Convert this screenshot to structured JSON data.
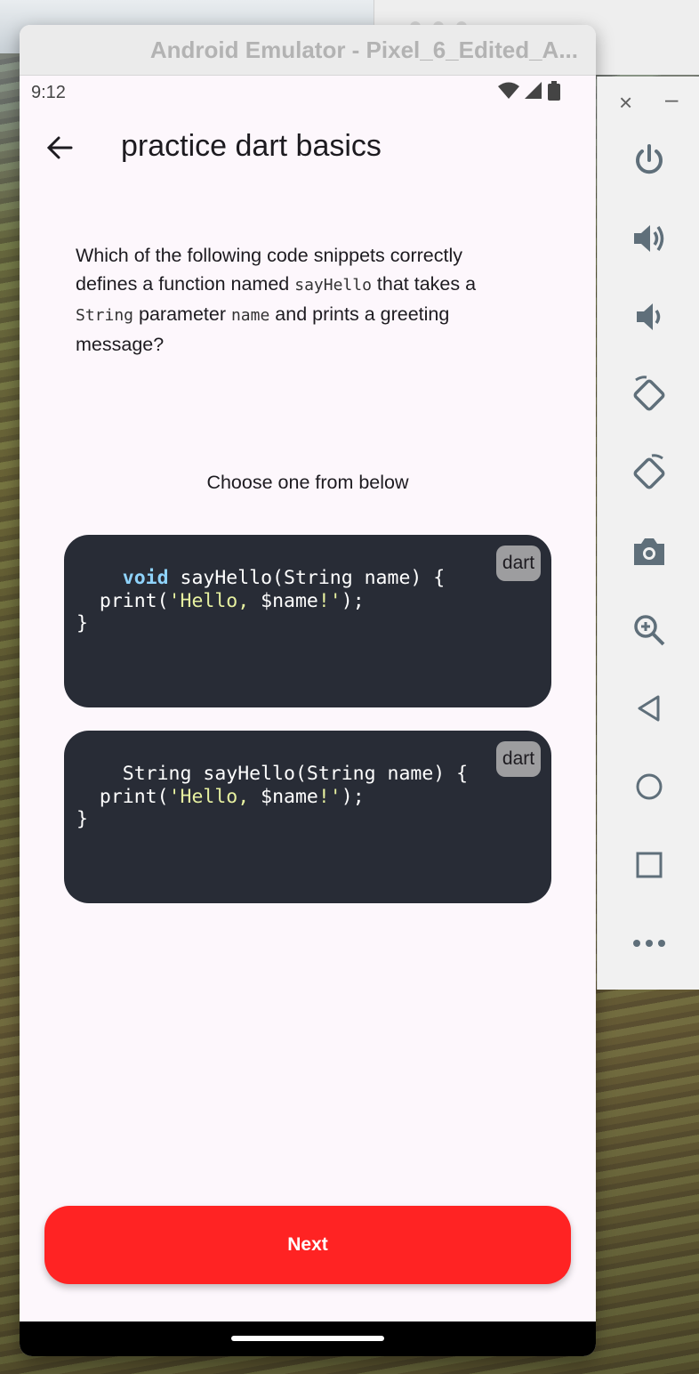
{
  "emulator": {
    "window_title": "Android Emulator - Pixel_6_Edited_A..."
  },
  "status_bar": {
    "time": "9:12",
    "icons": [
      "wifi-icon",
      "signal-icon",
      "battery-icon"
    ]
  },
  "app_bar": {
    "back_icon": "arrow-back-icon",
    "title": "practice dart basics"
  },
  "question": {
    "part1": "Which of the following code snippets correctly defines a function named ",
    "code1": "sayHello",
    "part2": " that takes a ",
    "code2": "String",
    "part3": " parameter ",
    "code3": "name",
    "part4": " and prints a greeting message?"
  },
  "prompt": "Choose one from below",
  "options": [
    {
      "language": "dart",
      "line1_keyword": "void",
      "line1_rest": " sayHello(String name) {",
      "line2_pre": "  print(",
      "line2_str": "'Hello, ",
      "line2_var": "$name",
      "line2_str2": "!'",
      "line2_post": ");",
      "line3": "}"
    },
    {
      "language": "dart",
      "line1_keyword": "",
      "line1_rest": "String sayHello(String name) {",
      "line2_pre": "  print(",
      "line2_str": "'Hello, ",
      "line2_var": "$name",
      "line2_str2": "!'",
      "line2_post": ");",
      "line3": "}"
    }
  ],
  "next_button": "Next",
  "toolbar": {
    "close": "×",
    "minimize": "–",
    "buttons": [
      "power-icon",
      "volume-up-icon",
      "volume-down-icon",
      "rotate-left-icon",
      "rotate-right-icon",
      "camera-icon",
      "zoom-icon",
      "back-icon",
      "home-icon",
      "overview-icon",
      "more-icon"
    ]
  },
  "colors": {
    "accent": "#ff2323",
    "code_background": "#282c36",
    "keyword": "#8fd3fb",
    "string": "#e7f1a0",
    "screen_background": "#fdf7fc"
  }
}
